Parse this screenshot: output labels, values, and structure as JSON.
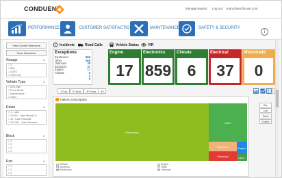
{
  "header": {
    "brand": "CONDUENT",
    "links": [
      "Manage reports",
      "Log out",
      "tuan.pham@xone.com"
    ]
  },
  "nav": {
    "tabs": [
      {
        "label": "PERFORMANCE",
        "icon": "bar-chart-icon"
      },
      {
        "label": "CUSTOMER SATISFACTION",
        "icon": "user-icon"
      },
      {
        "label": "MAINTENANCE",
        "icon": "wrench-icon"
      },
      {
        "label": "SAFETY & SECURITY",
        "icon": "shield-check-icon"
      }
    ],
    "info_glyph": "i"
  },
  "sidebar": {
    "view_selections": "View Current Selections",
    "clear_selections": "Clear Selections",
    "sections": [
      {
        "title": "Garage",
        "items": [
          "1",
          "665",
          "OATS",
          "OATS DC"
        ]
      },
      {
        "title": "Vehicle Type",
        "items": [
          "ADA Sign",
          "Fixed Route",
          "Maintenance",
          "Other"
        ]
      },
      {
        "title": "Route",
        "items": [
          "1 - Lake",
          "11/116 - Lake Stanely Tr",
          "16 - Lake Charlotte",
          "101/106 - Lake Samoset"
        ]
      },
      {
        "title": "Block",
        "items": [
          "1",
          "2",
          "3",
          "4"
        ]
      },
      {
        "title": "Run",
        "items": [
          "1",
          "2",
          "3"
        ]
      }
    ]
  },
  "filters": {
    "items": [
      "Incidents",
      "Road Calls",
      "Vehicle Status",
      "VIR"
    ]
  },
  "exceptions": {
    "title": "Exceptions",
    "rows": [
      {
        "name": "Electronics",
        "value": "859"
      },
      {
        "name": "Other",
        "value": "566"
      },
      {
        "name": "Unknown",
        "value": "39"
      },
      {
        "name": "Electrical",
        "value": "37"
      },
      {
        "name": "Engine",
        "value": "17"
      },
      {
        "name": "Climate",
        "value": "6"
      },
      {
        "name": "",
        "value": "0"
      },
      {
        "name": "",
        "value": "0"
      }
    ]
  },
  "kpis": [
    {
      "label": "Engine",
      "value": "17",
      "color": "#2e7d32"
    },
    {
      "label": "Electronics",
      "value": "859",
      "color": "#2e7d32"
    },
    {
      "label": "Climate",
      "value": "6",
      "color": "#2e7d32"
    },
    {
      "label": "Electrical",
      "value": "37",
      "color": "#c62828"
    },
    {
      "label": "Windshield",
      "value": "0",
      "color": "#f0ad4e"
    }
  ],
  "ranges": [
    "1 Day",
    "5 Days",
    "30 Days",
    "All"
  ],
  "chart": {
    "title": "Failure_Description",
    "tiles": [
      {
        "label": "Electronics",
        "color": "#8fbc1e"
      },
      {
        "label": "Other",
        "color": "#4caf50"
      },
      {
        "label": "Unknown",
        "color": "#f0b27a"
      },
      {
        "label": "Electrical",
        "color": "#e53935"
      },
      {
        "label": "Engine",
        "color": "#1e88e5"
      },
      {
        "label": "Clim...",
        "color": "#43a047"
      }
    ],
    "legend": [
      "Climate",
      "Electrical",
      "Electronics",
      "Engine",
      "Other",
      "Unknown"
    ]
  },
  "side_buttons": [
    "Bar",
    "Line",
    "Stack",
    "Scatter"
  ]
}
